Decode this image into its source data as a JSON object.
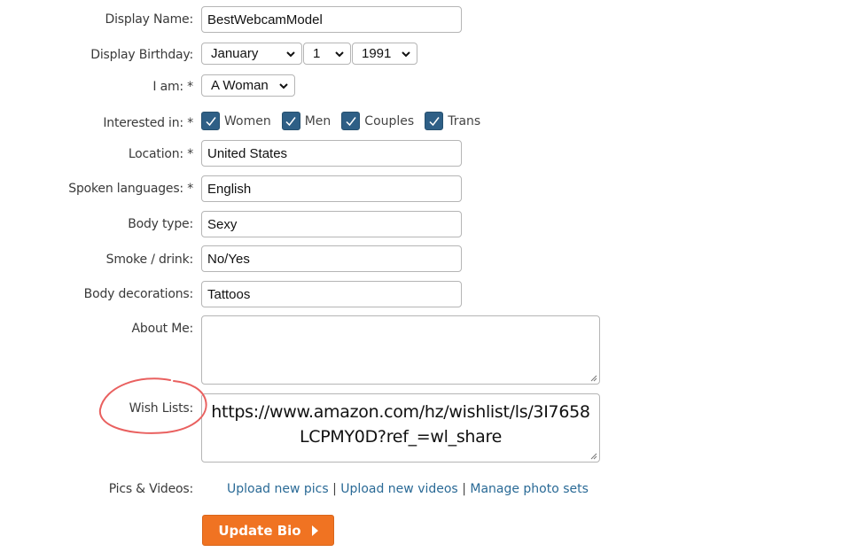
{
  "fields": {
    "display_name": {
      "label": "Display Name:",
      "value": "BestWebcamModel"
    },
    "display_birthday": {
      "label": "Display Birthday:",
      "month": "January",
      "day": "1",
      "year": "1991"
    },
    "i_am": {
      "label": "I am: *",
      "value": "A Woman"
    },
    "interested_in": {
      "label": "Interested in: *",
      "options": [
        {
          "label": "Women",
          "checked": true
        },
        {
          "label": "Men",
          "checked": true
        },
        {
          "label": "Couples",
          "checked": true
        },
        {
          "label": "Trans",
          "checked": true
        }
      ]
    },
    "location": {
      "label": "Location: *",
      "value": "United States"
    },
    "spoken_languages": {
      "label": "Spoken languages: *",
      "value": "English"
    },
    "body_type": {
      "label": "Body type:",
      "value": "Sexy"
    },
    "smoke_drink": {
      "label": "Smoke / drink:",
      "value": "No/Yes"
    },
    "body_decorations": {
      "label": "Body decorations:",
      "value": "Tattoos"
    },
    "about_me": {
      "label": "About Me:",
      "value": ""
    },
    "wish_lists": {
      "label": "Wish Lists:",
      "value": "https://www.amazon.com/hz/wishlist/ls/3I7658LCPMY0D?ref_=wl_share"
    },
    "pics_videos": {
      "label": "Pics & Videos:",
      "links": [
        "Upload new pics",
        "Upload new videos",
        "Manage photo sets"
      ],
      "separator": "|"
    }
  },
  "actions": {
    "update_bio": "Update Bio"
  },
  "colors": {
    "checkbox": "#2e5f86",
    "link": "#2a6a96",
    "button": "#f07322",
    "annotation": "#e9605f"
  }
}
